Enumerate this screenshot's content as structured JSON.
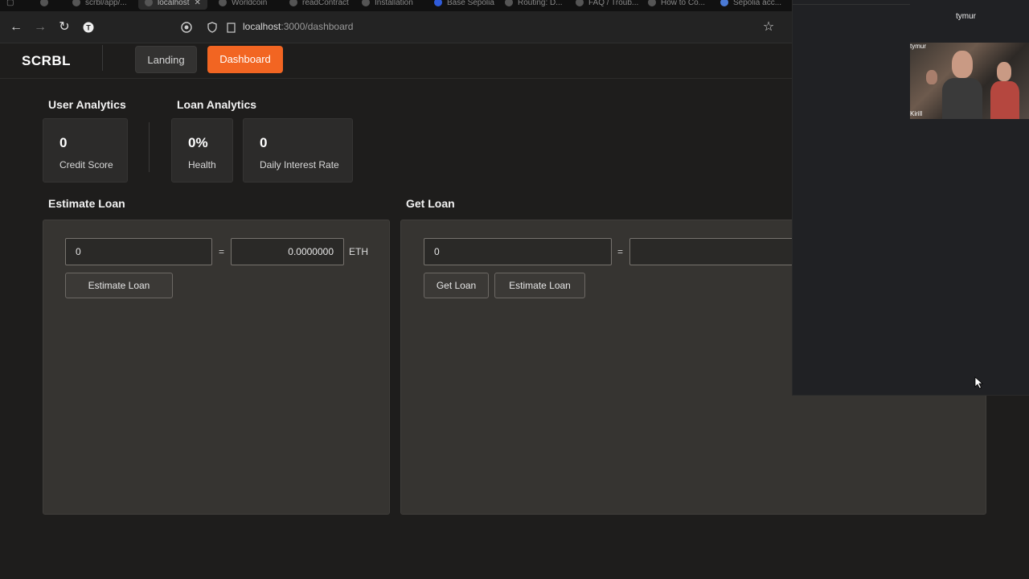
{
  "browser": {
    "tabs": [
      {
        "label": "scrbl/app/..."
      },
      {
        "label": "localhost"
      },
      {
        "label": "Worldcoin"
      },
      {
        "label": "readContract"
      },
      {
        "label": "Installation"
      },
      {
        "label": "Base Sepolia"
      },
      {
        "label": "Routing: D..."
      },
      {
        "label": "FAQ / Troub..."
      },
      {
        "label": "How to Co..."
      },
      {
        "label": "Sepolia acc..."
      }
    ],
    "url_host": "localhost",
    "url_path": ":3000/dashboard",
    "icons": [
      "back-icon",
      "forward-icon",
      "reload-icon",
      "profile-icon",
      "shield-icon",
      "page-info-icon",
      "bookmark-star-icon"
    ]
  },
  "call": {
    "top_name": "tymur",
    "video_name_top": "tymur",
    "video_name_bottom": "Kirill"
  },
  "header": {
    "logo": "SCRBL",
    "nav": [
      {
        "label": "Landing",
        "active": false
      },
      {
        "label": "Dashboard",
        "active": true
      }
    ],
    "accent": "#f26522"
  },
  "user_analytics": {
    "title": "User Analytics",
    "cards": [
      {
        "value": "0",
        "label": "Credit Score"
      }
    ]
  },
  "loan_analytics": {
    "title": "Loan Analytics",
    "cards": [
      {
        "value": "0%",
        "label": "Health"
      },
      {
        "value": "0",
        "label": "Daily Interest Rate"
      }
    ]
  },
  "estimate_loan": {
    "title": "Estimate Loan",
    "amount_value": "0",
    "eq": "=",
    "eth_value": "0.0000000",
    "unit": "ETH",
    "button": "Estimate Loan"
  },
  "get_loan": {
    "title": "Get Loan",
    "amount_value": "0",
    "eq": "=",
    "eth_value": "",
    "buttons": {
      "get": "Get Loan",
      "estimate": "Estimate Loan"
    }
  }
}
